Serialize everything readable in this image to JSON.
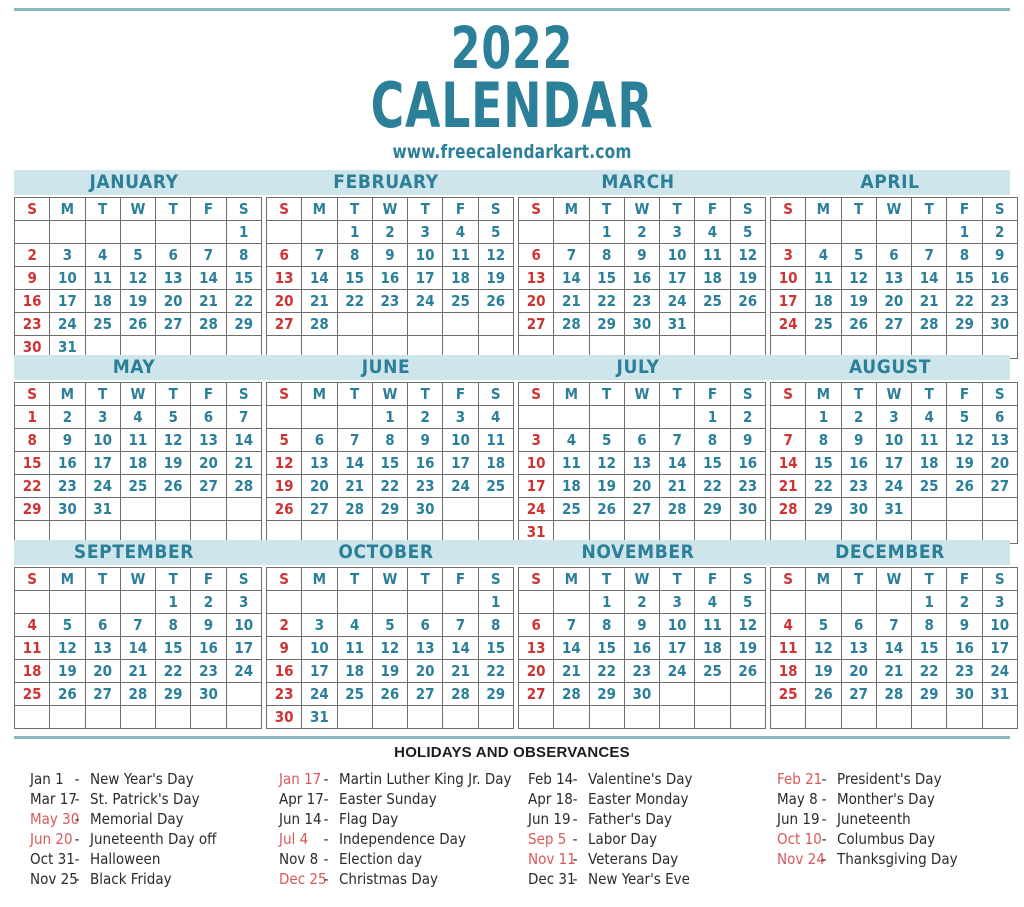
{
  "header": {
    "year": "2022",
    "word": "CALENDAR",
    "url": "www.freecalendarkart.com"
  },
  "colors": {
    "teal": "#2c7f98",
    "band": "#cfe5ec",
    "rule": "#87b8c4",
    "sunday_red": "#cf3434",
    "holiday_red": "#d95858",
    "grid": "#6e6e6e"
  },
  "weekdays": [
    "S",
    "M",
    "T",
    "W",
    "T",
    "F",
    "S"
  ],
  "months": [
    {
      "name": "JANUARY",
      "weeks": [
        [
          "",
          "",
          "",
          "",
          "",
          "",
          "1"
        ],
        [
          "2",
          "3",
          "4",
          "5",
          "6",
          "7",
          "8"
        ],
        [
          "9",
          "10",
          "11",
          "12",
          "13",
          "14",
          "15"
        ],
        [
          "16",
          "17",
          "18",
          "19",
          "20",
          "21",
          "22"
        ],
        [
          "23",
          "24",
          "25",
          "26",
          "27",
          "28",
          "29"
        ],
        [
          "30",
          "31",
          "",
          "",
          "",
          "",
          ""
        ]
      ]
    },
    {
      "name": "FEBRUARY",
      "weeks": [
        [
          "",
          "",
          "1",
          "2",
          "3",
          "4",
          "5"
        ],
        [
          "6",
          "7",
          "8",
          "9",
          "10",
          "11",
          "12"
        ],
        [
          "13",
          "14",
          "15",
          "16",
          "17",
          "18",
          "19"
        ],
        [
          "20",
          "21",
          "22",
          "23",
          "24",
          "25",
          "26"
        ],
        [
          "27",
          "28",
          "",
          "",
          "",
          "",
          ""
        ],
        [
          "",
          "",
          "",
          "",
          "",
          "",
          ""
        ]
      ]
    },
    {
      "name": "MARCH",
      "weeks": [
        [
          "",
          "",
          "1",
          "2",
          "3",
          "4",
          "5"
        ],
        [
          "6",
          "7",
          "8",
          "9",
          "10",
          "11",
          "12"
        ],
        [
          "13",
          "14",
          "15",
          "16",
          "17",
          "18",
          "19"
        ],
        [
          "20",
          "21",
          "22",
          "23",
          "24",
          "25",
          "26"
        ],
        [
          "27",
          "28",
          "29",
          "30",
          "31",
          "",
          ""
        ],
        [
          "",
          "",
          "",
          "",
          "",
          "",
          ""
        ]
      ]
    },
    {
      "name": "APRIL",
      "weeks": [
        [
          "",
          "",
          "",
          "",
          "",
          "1",
          "2"
        ],
        [
          "3",
          "4",
          "5",
          "6",
          "7",
          "8",
          "9"
        ],
        [
          "10",
          "11",
          "12",
          "13",
          "14",
          "15",
          "16"
        ],
        [
          "17",
          "18",
          "19",
          "20",
          "21",
          "22",
          "23"
        ],
        [
          "24",
          "25",
          "26",
          "27",
          "28",
          "29",
          "30"
        ],
        [
          "",
          "",
          "",
          "",
          "",
          "",
          ""
        ]
      ]
    },
    {
      "name": "MAY",
      "weeks": [
        [
          "1",
          "2",
          "3",
          "4",
          "5",
          "6",
          "7"
        ],
        [
          "8",
          "9",
          "10",
          "11",
          "12",
          "13",
          "14"
        ],
        [
          "15",
          "16",
          "17",
          "18",
          "19",
          "20",
          "21"
        ],
        [
          "22",
          "23",
          "24",
          "25",
          "26",
          "27",
          "28"
        ],
        [
          "29",
          "30",
          "31",
          "",
          "",
          "",
          ""
        ],
        [
          "",
          "",
          "",
          "",
          "",
          "",
          ""
        ]
      ]
    },
    {
      "name": "JUNE",
      "weeks": [
        [
          "",
          "",
          "",
          "1",
          "2",
          "3",
          "4"
        ],
        [
          "5",
          "6",
          "7",
          "8",
          "9",
          "10",
          "11"
        ],
        [
          "12",
          "13",
          "14",
          "15",
          "16",
          "17",
          "18"
        ],
        [
          "19",
          "20",
          "21",
          "22",
          "23",
          "24",
          "25"
        ],
        [
          "26",
          "27",
          "28",
          "29",
          "30",
          "",
          ""
        ],
        [
          "",
          "",
          "",
          "",
          "",
          "",
          ""
        ]
      ]
    },
    {
      "name": "JULY",
      "weeks": [
        [
          "",
          "",
          "",
          "",
          "",
          "1",
          "2"
        ],
        [
          "3",
          "4",
          "5",
          "6",
          "7",
          "8",
          "9"
        ],
        [
          "10",
          "11",
          "12",
          "13",
          "14",
          "15",
          "16"
        ],
        [
          "17",
          "18",
          "19",
          "20",
          "21",
          "22",
          "23"
        ],
        [
          "24",
          "25",
          "26",
          "27",
          "28",
          "29",
          "30"
        ],
        [
          "31",
          "",
          "",
          "",
          "",
          "",
          ""
        ]
      ]
    },
    {
      "name": "AUGUST",
      "weeks": [
        [
          "",
          "1",
          "2",
          "3",
          "4",
          "5",
          "6"
        ],
        [
          "7",
          "8",
          "9",
          "10",
          "11",
          "12",
          "13"
        ],
        [
          "14",
          "15",
          "16",
          "17",
          "18",
          "19",
          "20"
        ],
        [
          "21",
          "22",
          "23",
          "24",
          "25",
          "26",
          "27"
        ],
        [
          "28",
          "29",
          "30",
          "31",
          "",
          "",
          ""
        ],
        [
          "",
          "",
          "",
          "",
          "",
          "",
          ""
        ]
      ]
    },
    {
      "name": "SEPTEMBER",
      "weeks": [
        [
          "",
          "",
          "",
          "",
          "1",
          "2",
          "3"
        ],
        [
          "4",
          "5",
          "6",
          "7",
          "8",
          "9",
          "10"
        ],
        [
          "11",
          "12",
          "13",
          "14",
          "15",
          "16",
          "17"
        ],
        [
          "18",
          "19",
          "20",
          "21",
          "22",
          "23",
          "24"
        ],
        [
          "25",
          "26",
          "27",
          "28",
          "29",
          "30",
          ""
        ],
        [
          "",
          "",
          "",
          "",
          "",
          "",
          ""
        ]
      ]
    },
    {
      "name": "OCTOBER",
      "weeks": [
        [
          "",
          "",
          "",
          "",
          "",
          "",
          "1"
        ],
        [
          "2",
          "3",
          "4",
          "5",
          "6",
          "7",
          "8"
        ],
        [
          "9",
          "10",
          "11",
          "12",
          "13",
          "14",
          "15"
        ],
        [
          "16",
          "17",
          "18",
          "19",
          "20",
          "21",
          "22"
        ],
        [
          "23",
          "24",
          "25",
          "26",
          "27",
          "28",
          "29"
        ],
        [
          "30",
          "31",
          "",
          "",
          "",
          "",
          ""
        ]
      ]
    },
    {
      "name": "NOVEMBER",
      "weeks": [
        [
          "",
          "",
          "1",
          "2",
          "3",
          "4",
          "5"
        ],
        [
          "6",
          "7",
          "8",
          "9",
          "10",
          "11",
          "12"
        ],
        [
          "13",
          "14",
          "15",
          "16",
          "17",
          "18",
          "19"
        ],
        [
          "20",
          "21",
          "22",
          "23",
          "24",
          "25",
          "26"
        ],
        [
          "27",
          "28",
          "29",
          "30",
          "",
          "",
          ""
        ],
        [
          "",
          "",
          "",
          "",
          "",
          "",
          ""
        ]
      ]
    },
    {
      "name": "DECEMBER",
      "weeks": [
        [
          "",
          "",
          "",
          "",
          "1",
          "2",
          "3"
        ],
        [
          "4",
          "5",
          "6",
          "7",
          "8",
          "9",
          "10"
        ],
        [
          "11",
          "12",
          "13",
          "14",
          "15",
          "16",
          "17"
        ],
        [
          "18",
          "19",
          "20",
          "21",
          "22",
          "23",
          "24"
        ],
        [
          "25",
          "26",
          "27",
          "28",
          "29",
          "30",
          "31"
        ],
        [
          "",
          "",
          "",
          "",
          "",
          "",
          ""
        ]
      ]
    }
  ],
  "holidays": {
    "title": "HOLIDAYS AND OBSERVANCES",
    "dash": "-",
    "columns": [
      [
        {
          "date": "Jan 1",
          "name": "New Year's Day",
          "red": false
        },
        {
          "date": "Mar 17",
          "name": "St. Patrick's Day",
          "red": false
        },
        {
          "date": "May 30",
          "name": "Memorial Day",
          "red": true
        },
        {
          "date": "Jun 20",
          "name": "Juneteenth Day off",
          "red": true
        },
        {
          "date": "Oct 31",
          "name": "Halloween",
          "red": false
        },
        {
          "date": "Nov 25",
          "name": "Black Friday",
          "red": false
        }
      ],
      [
        {
          "date": "Jan 17",
          "name": "Martin Luther King Jr. Day",
          "red": true
        },
        {
          "date": "Apr 17",
          "name": "Easter Sunday",
          "red": false
        },
        {
          "date": "Jun 14",
          "name": "Flag Day",
          "red": false
        },
        {
          "date": "Jul 4",
          "name": "Independence Day",
          "red": true
        },
        {
          "date": "Nov 8",
          "name": "Election day",
          "red": false
        },
        {
          "date": "Dec 25",
          "name": "Christmas Day",
          "red": true
        }
      ],
      [
        {
          "date": "Feb 14",
          "name": "Valentine's Day",
          "red": false
        },
        {
          "date": "Apr 18",
          "name": "Easter Monday",
          "red": false
        },
        {
          "date": "Jun 19",
          "name": "Father's Day",
          "red": false
        },
        {
          "date": "Sep 5",
          "name": "Labor Day",
          "red": true
        },
        {
          "date": "Nov 11",
          "name": "Veterans Day",
          "red": true
        },
        {
          "date": "Dec 31",
          "name": "New Year's Eve",
          "red": false
        }
      ],
      [
        {
          "date": "Feb 21",
          "name": "President's Day",
          "red": true
        },
        {
          "date": "May 8",
          "name": "Monther's Day",
          "red": false
        },
        {
          "date": "Jun 19",
          "name": "Juneteenth",
          "red": false
        },
        {
          "date": "Oct 10",
          "name": "Columbus Day",
          "red": true
        },
        {
          "date": "Nov 24",
          "name": "Thanksgiving Day",
          "red": true
        }
      ]
    ]
  }
}
